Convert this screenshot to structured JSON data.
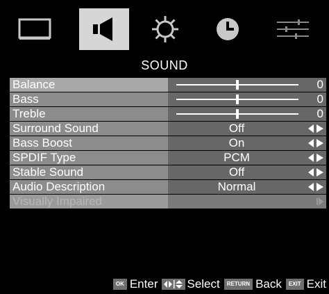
{
  "menu_title": "SOUND",
  "tabs": [
    {
      "icon": "picture-icon",
      "active": false
    },
    {
      "icon": "speaker-icon",
      "active": true
    },
    {
      "icon": "gear-icon",
      "active": false
    },
    {
      "icon": "clock-icon",
      "active": false
    },
    {
      "icon": "sliders-icon",
      "active": false
    }
  ],
  "rows": [
    {
      "label": "Balance",
      "value": "0",
      "slider": 0.5
    },
    {
      "label": "Bass",
      "value": "0",
      "slider": 0.5
    },
    {
      "label": "Treble",
      "value": "0",
      "slider": 0.5
    },
    {
      "label": "Surround Sound",
      "value": "Off"
    },
    {
      "label": "Bass Boost",
      "value": "On"
    },
    {
      "label": "SPDIF Type",
      "value": "PCM"
    },
    {
      "label": "Stable Sound",
      "value": "Off"
    },
    {
      "label": "Audio Description",
      "value": "Normal"
    },
    {
      "label": "Visually Impaired",
      "value": ""
    }
  ],
  "footer": {
    "ok_key": "OK",
    "enter_label": "Enter",
    "select_label": "Select",
    "return_key": "RETURN",
    "back_label": "Back",
    "exit_key": "EXIT",
    "exit_label": "Exit"
  },
  "colors": {
    "background": "#000000",
    "label_bg": "#8c8c8c",
    "value_bg": "#676767",
    "active_tab": "#d6d6d6"
  }
}
